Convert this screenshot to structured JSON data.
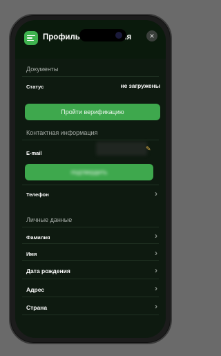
{
  "header": {
    "title_visible": "Профиль",
    "title_tail": "ация"
  },
  "documents": {
    "section_title": "Документы",
    "status_label": "Статус",
    "status_value": "не загружены",
    "verify_button": "Пройти верификацию"
  },
  "contact": {
    "section_title": "Контактная информация",
    "email_label": "E-mail",
    "confirm_button": "подтвердить",
    "phone_label": "Телефон"
  },
  "personal": {
    "section_title": "Личные данные",
    "rows": [
      "Фамилия",
      "Имя",
      "Дата рождения",
      "Адрес",
      "Страна"
    ]
  },
  "icons": {
    "menu": "menu-icon",
    "close": "close-icon",
    "edit": "pencil-icon",
    "chevron": "chevron-right-icon"
  },
  "colors": {
    "accent": "#3ea84d",
    "background": "#0e1a10"
  }
}
